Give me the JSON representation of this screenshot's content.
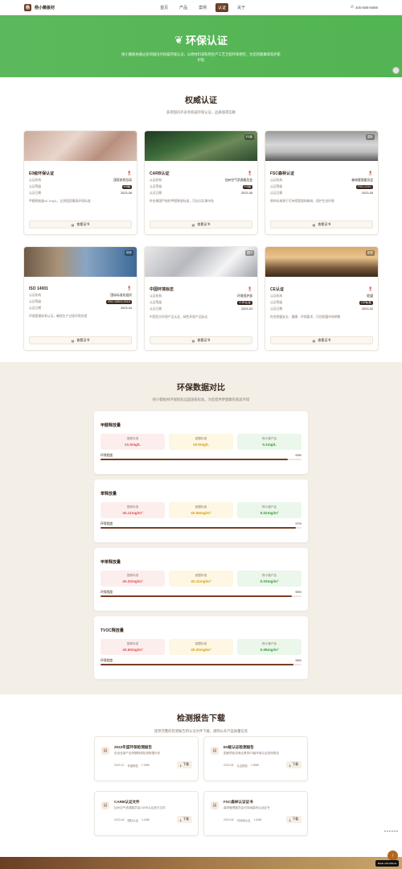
{
  "header": {
    "brand": "杨小薇板材",
    "logo_glyph": "杨",
    "nav": [
      "首页",
      "产品",
      "案例",
      "认证",
      "关于"
    ],
    "active_nav": "认证",
    "phone": "400-888-8888"
  },
  "hero": {
    "title": "环保认证",
    "subtitle": "杨小薇板材通过多项国内外权威环保认证，从原材料采购到生产工艺全程环保把控，为您的健康保驾护航护航"
  },
  "certs_section": {
    "title": "权威认证",
    "subtitle": "获得国内外多项权威环保认证，品质值得信赖",
    "field_labels": [
      "认证机构",
      "认证等级",
      "认证日期"
    ],
    "download_label": "查看证书",
    "cards": [
      {
        "name": "E0级环保认证",
        "org": "国家质检总局",
        "level": "E0级",
        "date": "2023-08",
        "desc": "甲醛释放量≤0.1mg/L，达到国家最高环保标准",
        "tag": "",
        "img": "fabric"
      },
      {
        "name": "CARB认证",
        "org": "加州空气资源委员会",
        "level": "P2级",
        "date": "2023-06",
        "desc": "符合美国严格的甲醛释放标准，可出口北美市场",
        "tag": "E1级",
        "img": "forest"
      },
      {
        "name": "FSC森林认证",
        "org": "森林管理委员会",
        "level": "FSC-COC",
        "date": "2023-05",
        "desc": "原材料来源于可持续管理的森林，保护生态环境",
        "tag": "国际",
        "img": "fog"
      },
      {
        "name": "ISO 14001",
        "org": "国际标准化组织",
        "level": "ISO 14001:2015",
        "date": "2023-04",
        "desc": "环境管理体系认证，确保生产过程环保合规",
        "tag": "体系",
        "img": "street"
      },
      {
        "name": "中国环境标志",
        "org": "环境保护部",
        "level": "十环认证",
        "date": "2023-03",
        "desc": "中国官方环保产品认证，绿色环保产品标志",
        "tag": "国内",
        "img": "blur"
      },
      {
        "name": "CE认证",
        "org": "欧盟",
        "level": "CE标准",
        "date": "2023-02",
        "desc": "符合欧盟安全、健康、环保要求，可在欧盟市场销售",
        "tag": "欧盟",
        "img": "city"
      }
    ]
  },
  "compare_section": {
    "title": "环保数据对比",
    "subtitle": "杨小薇板材环保指标远超国家标准，为您提供更健康的家居环境",
    "col_labels": [
      "国家标准",
      "欧盟标准",
      "杨小薇产品"
    ],
    "progress_label": "环保程度",
    "items": [
      {
        "name": "甲醛释放量",
        "values": [
          "≤1.5mg/L",
          "≤0.5mg/L",
          "0.1mg/L"
        ],
        "percent": 93,
        "percent_label": "93%"
      },
      {
        "name": "苯释放量",
        "values": [
          "≤0.11mg/m³",
          "≤0.06mg/m³",
          "0.02mg/m³"
        ],
        "percent": 97,
        "percent_label": "97%"
      },
      {
        "name": "甲苯释放量",
        "values": [
          "≤0.20mg/m³",
          "≤0.11mg/m³",
          "0.03mg/m³"
        ],
        "percent": 95,
        "percent_label": "95%"
      },
      {
        "name": "TVOC释放量",
        "values": [
          "≤0.60mg/m³",
          "≤0.30mg/m³",
          "0.08mg/m³"
        ],
        "percent": 96,
        "percent_label": "96%"
      }
    ]
  },
  "reports_section": {
    "title": "检测报告下载",
    "subtitle": "提供完整的检测报告和认证文件下载，透明公开产品质量信息",
    "download_label": "下载",
    "reports": [
      {
        "title": "2023年度环保检测报告",
        "desc": "包含全部产品甲醛释放检测数据分析",
        "date": "2023-12",
        "type": "年度报告",
        "size": "2.3MB"
      },
      {
        "title": "E0级认证检测报告",
        "desc": "国家质检总局出具的E0级环保认证检测报告",
        "date": "2023-08",
        "type": "认证报告",
        "size": "1.8MB"
      },
      {
        "title": "CARB认证文件",
        "desc": "加州空气资源委员会CARB认证官方文件",
        "date": "2023-06",
        "type": "国际认证",
        "size": "3.2MB"
      },
      {
        "title": "FSC森林认证证书",
        "desc": "森林管理委员会可持续森林认证证书",
        "date": "2023-05",
        "type": "可持续认证",
        "size": "1.5MB"
      }
    ]
  },
  "footer": {
    "badge": "Made with Manus",
    "to_top": "↑"
  },
  "colors": {
    "brand": "#6b3e26",
    "hero_green": "#5cb85c",
    "compare_bg": "#f4efe6"
  }
}
